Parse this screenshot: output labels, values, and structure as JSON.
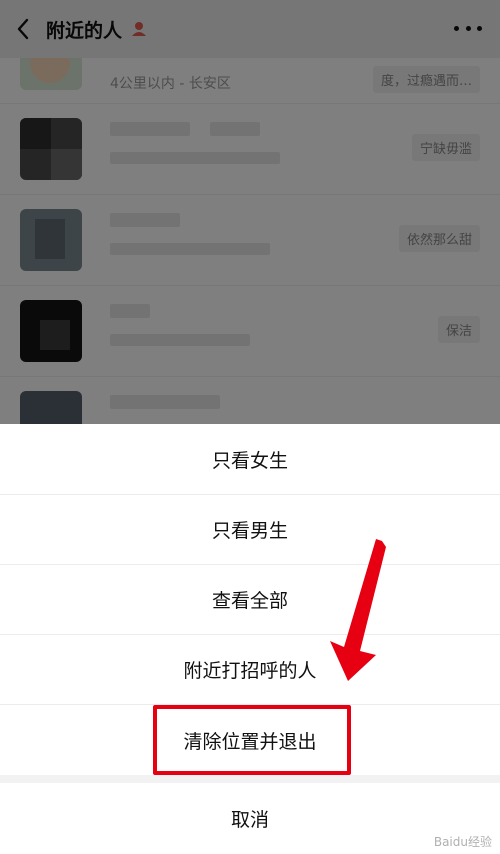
{
  "header": {
    "title": "附近的人",
    "back_icon": "chevron-left-icon",
    "more_icon": "more-dots-icon"
  },
  "list": {
    "rows": [
      {
        "distance": "4公里以内 - 长安区",
        "tag": "度，过瘾遇而…"
      },
      {
        "tag": "宁缺毋滥"
      },
      {
        "tag": "依然那么甜"
      },
      {
        "tag": "保洁"
      },
      {
        "tag": ""
      }
    ]
  },
  "action_sheet": {
    "options": [
      {
        "label": "只看女生"
      },
      {
        "label": "只看男生"
      },
      {
        "label": "查看全部"
      },
      {
        "label": "附近打招呼的人"
      },
      {
        "label": "清除位置并退出"
      }
    ],
    "cancel": "取消"
  },
  "watermark": "Baidu经验",
  "colors": {
    "highlight": "#e60012"
  }
}
